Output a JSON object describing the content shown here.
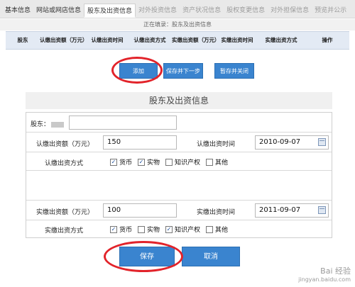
{
  "tabs": [
    {
      "label": "基本信息",
      "state": "normal"
    },
    {
      "label": "网站或网店信息",
      "state": "normal"
    },
    {
      "label": "股东及出资信息",
      "state": "active"
    },
    {
      "label": "对外投资信息",
      "state": "disabled"
    },
    {
      "label": "资产状况信息",
      "state": "disabled"
    },
    {
      "label": "股权变更信息",
      "state": "disabled"
    },
    {
      "label": "对外担保信息",
      "state": "disabled"
    },
    {
      "label": "预览并公示",
      "state": "disabled"
    }
  ],
  "filling_status": "正在填录：股东及出资信息",
  "table": {
    "headers": [
      "股东",
      "认缴出资额（万元）",
      "认缴出资时间",
      "认缴出资方式",
      "实缴出资额（万元）",
      "实缴出资时间",
      "实缴出资方式",
      "操作"
    ]
  },
  "actions": {
    "add": "添加",
    "save_next": "保存并下一步",
    "save_close": "暂存并关闭"
  },
  "form": {
    "title": "股东及出资信息",
    "shareholder_label": "股东：",
    "subscribed_amount_label": "认缴出资额（万元）",
    "subscribed_amount_value": "150",
    "subscribed_time_label": "认缴出资时间",
    "subscribed_time_value": "2010-09-07",
    "subscribed_method_label": "认缴出资方式",
    "subscribed_methods": [
      {
        "label": "货币",
        "checked": true
      },
      {
        "label": "实物",
        "checked": true
      },
      {
        "label": "知识产权",
        "checked": false
      },
      {
        "label": "其他",
        "checked": false
      }
    ],
    "paid_amount_label": "实缴出资额（万元）",
    "paid_amount_value": "100",
    "paid_time_label": "实缴出资时间",
    "paid_time_value": "2011-09-07",
    "paid_method_label": "实缴出资方式",
    "paid_methods": [
      {
        "label": "货币",
        "checked": true
      },
      {
        "label": "实物",
        "checked": false
      },
      {
        "label": "知识产权",
        "checked": true
      },
      {
        "label": "其他",
        "checked": false
      }
    ],
    "save": "保存",
    "cancel": "取消"
  },
  "watermark": {
    "line1": "Bai 经验",
    "line2": "jingyan.baidu.com"
  },
  "colors": {
    "accent": "#3a84cf",
    "highlight": "#e2232a"
  }
}
